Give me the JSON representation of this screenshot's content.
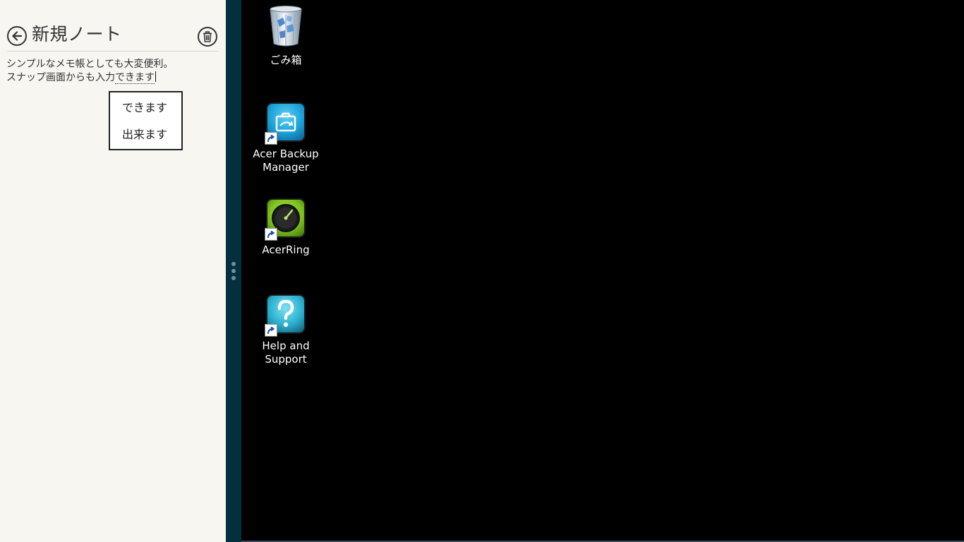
{
  "note_app": {
    "title": "新規ノート",
    "body_line1": "シンプルなメモ帳としても大変便利。",
    "body_line2_committed": "スナップ画面からも入力",
    "body_line2_composing": "できます",
    "ime_candidates": [
      {
        "label": "できます"
      },
      {
        "label": "出来ます"
      }
    ]
  },
  "desktop": {
    "icons": [
      {
        "label": "ごみ箱"
      },
      {
        "label_line1": "Acer Backup",
        "label_line2": "Manager"
      },
      {
        "label": "AcerRing"
      },
      {
        "label_line1": "Help and",
        "label_line2": "Support"
      }
    ]
  },
  "colors": {
    "note_background": "#f7f6f1",
    "splitter": "#04303e",
    "desktop_background": "#000000",
    "backup_tile": "#1aa0d8",
    "acerring_tile": "#7cc21e",
    "help_tile": "#2ab0d0"
  },
  "icons": {
    "back": "arrow-left-circle-icon",
    "delete": "trash-icon",
    "recycle_bin": "recycle-bin-icon",
    "backup": "backup-manager-icon",
    "acerring": "acerring-icon",
    "help": "help-question-icon",
    "shortcut": "shortcut-arrow-icon"
  }
}
